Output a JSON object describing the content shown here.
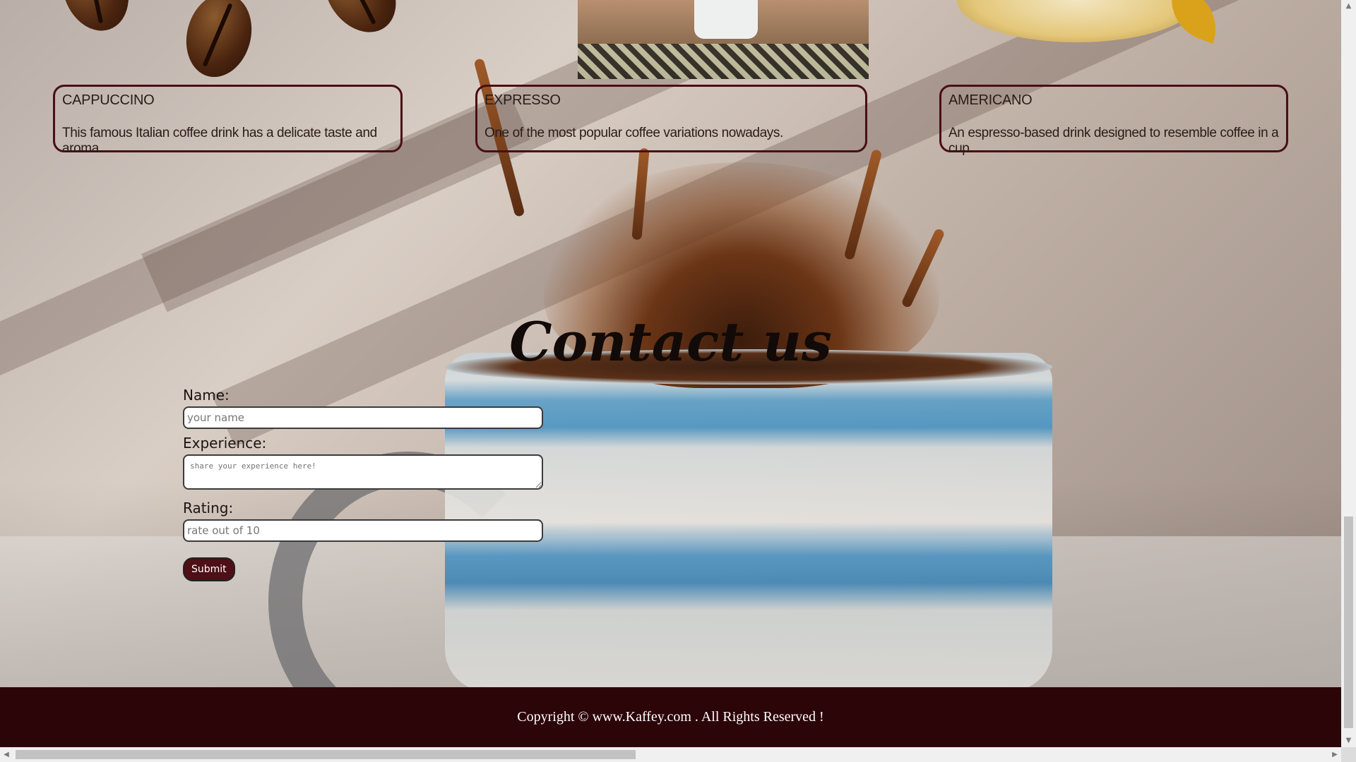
{
  "cards": [
    {
      "title": "CAPPUCCINO",
      "description": "This famous Italian coffee drink has a delicate taste and aroma."
    },
    {
      "title": "EXPRESSO",
      "description": "One of the most popular coffee variations nowadays."
    },
    {
      "title": "AMERICANO",
      "description": "An espresso-based drink designed to resemble coffee in a cup."
    }
  ],
  "contact": {
    "title": "Contact us",
    "name_label": "Name:",
    "name_placeholder": "your name",
    "experience_label": "Experience:",
    "experience_placeholder": "share your experience here!",
    "rating_label": "Rating:",
    "rating_placeholder": "rate out of 10",
    "submit_label": "Submit"
  },
  "footer": {
    "copyright": "Copyright © www.Kaffey.com . All Rights Reserved !"
  },
  "colors": {
    "accent": "#4e0f16",
    "footer_bg": "#2c0509",
    "card_border": "#4a0e14"
  }
}
